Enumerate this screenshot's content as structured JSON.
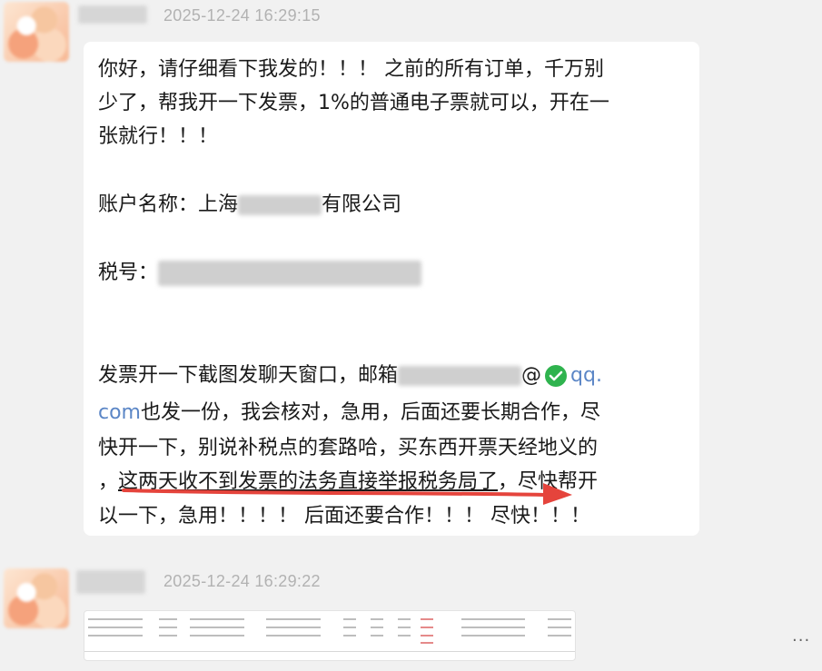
{
  "messages": [
    {
      "timestamp": "2025-12-24 16:29:15",
      "lines": {
        "l1": "你好，请仔细看下我发的！！！ 之前的所有订单，千万别",
        "l2": "少了，帮我开一下发票，1%的普通电子票就可以，开在一",
        "l3": "张就行！！！",
        "account_label": "账户名称：上海",
        "account_suffix": "有限公司",
        "tax_label": "税号：",
        "l6_prefix": "发票开一下截图发聊天窗口，邮箱",
        "l6_at": "@",
        "l6_link": "qq.",
        "l7_link": "com",
        "l7_rest": "也发一份，我会核对，急用，后面还要长期合作，尽",
        "l8": "快开一下，别说补税点的套路哈，买东西开票天经地义的",
        "l9_a": "，",
        "l9_underlined": "这两天收不到发票的法务直接举报税务局了",
        "l9_b": "，尽快帮开",
        "l10": "以一下，急用！！！！ 后面还要合作！！！ 尽快！！！"
      }
    },
    {
      "timestamp": "2025-12-24 16:29:22"
    }
  ],
  "more_label": "...",
  "colors": {
    "background": "#f1f1f1",
    "bubble": "#ffffff",
    "link": "#5b86c6",
    "arrow": "#e5443c",
    "check": "#2fb34e"
  },
  "icons": {
    "verified": "check-circle-icon",
    "annotation": "red-arrow"
  }
}
